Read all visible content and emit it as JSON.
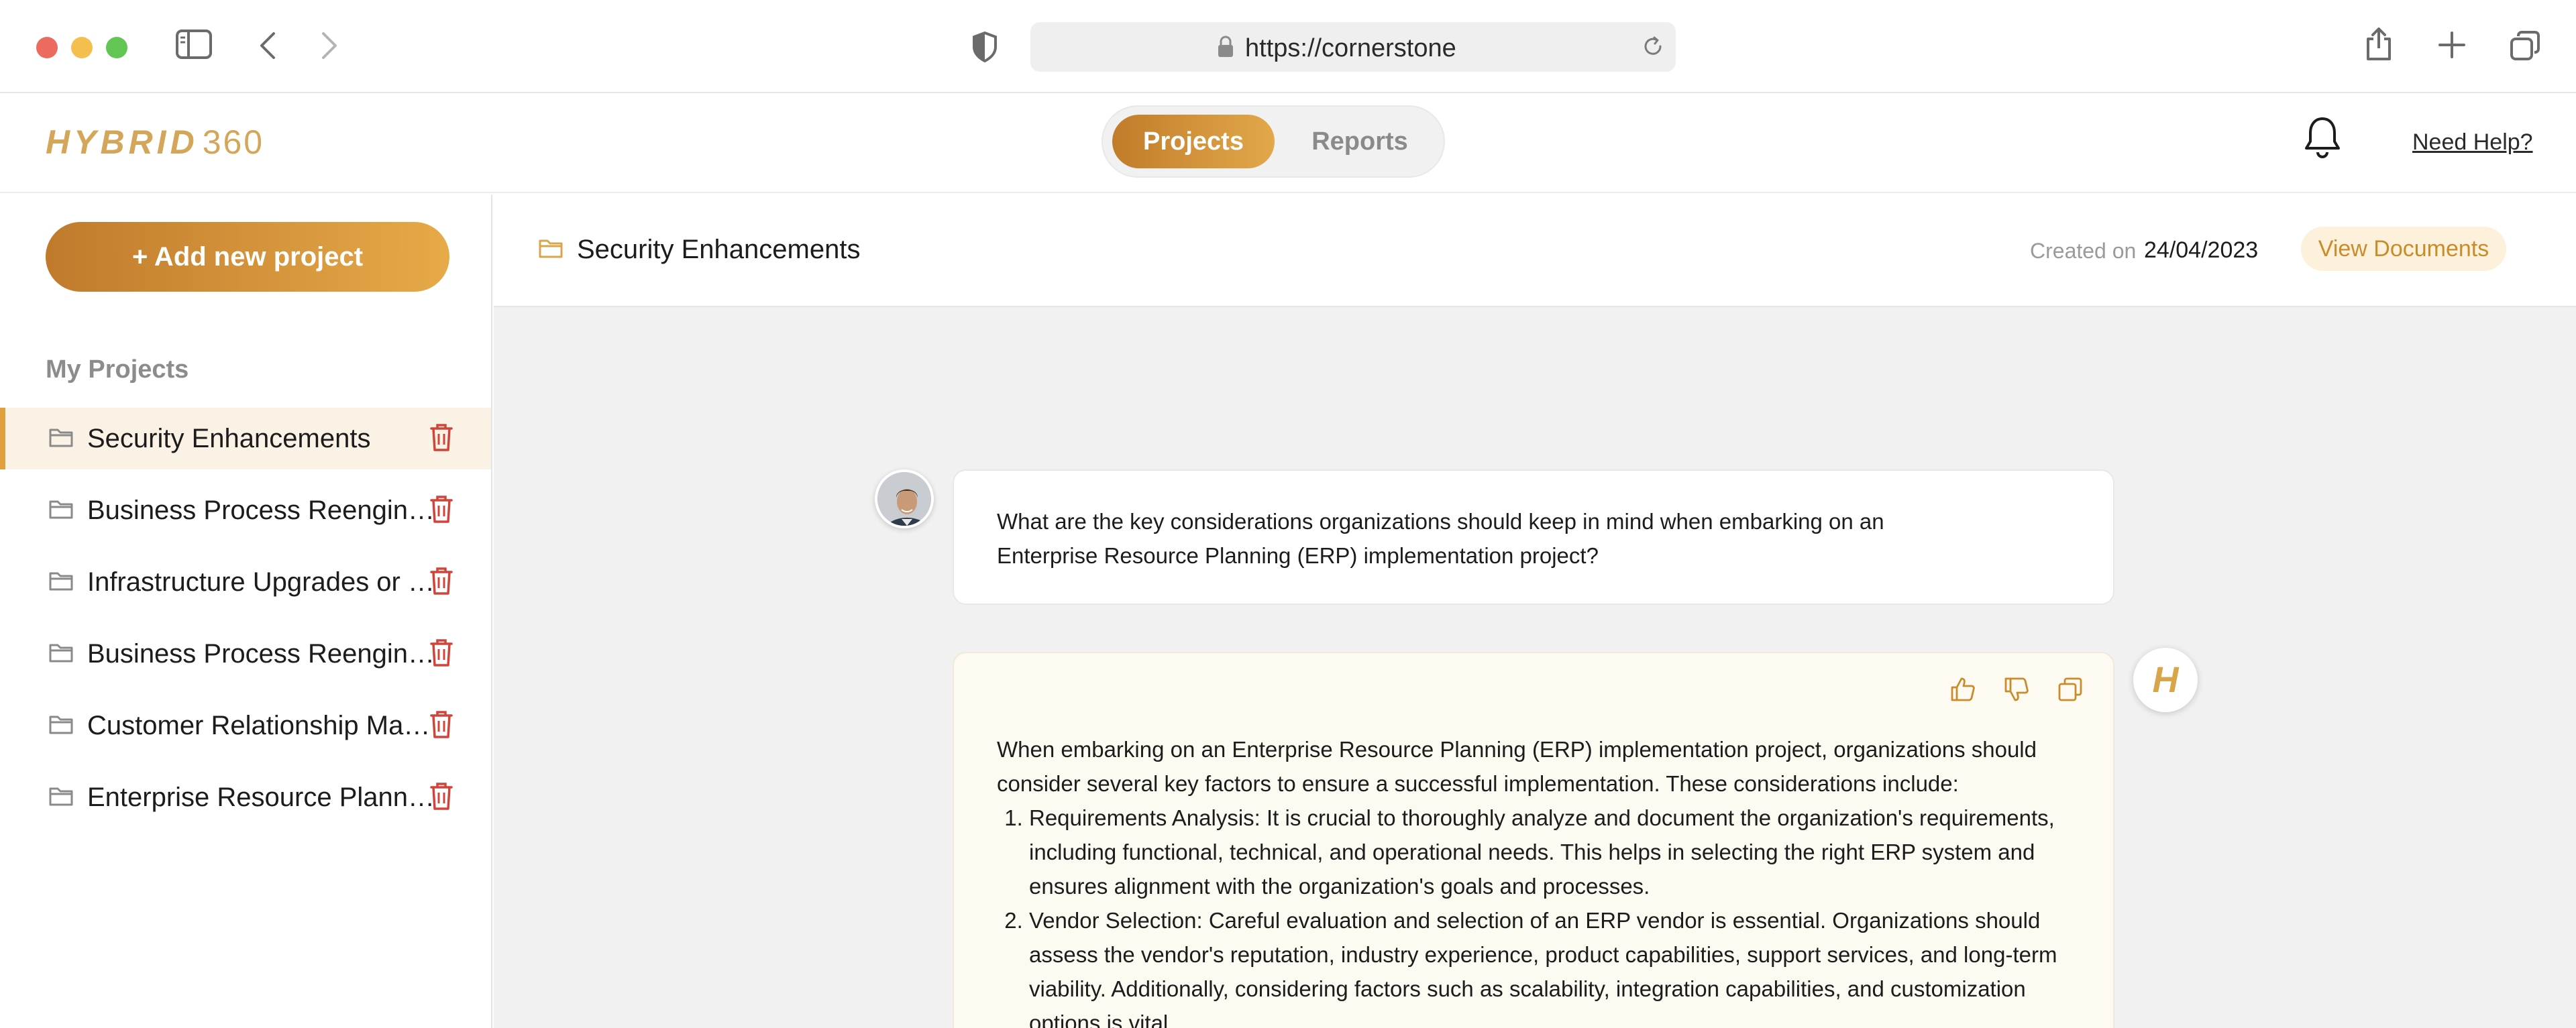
{
  "browser": {
    "url": "https://cornerstone"
  },
  "header": {
    "logo_bold": "HYBRID",
    "logo_num": "360",
    "tabs": [
      {
        "label": "Projects",
        "active": true
      },
      {
        "label": "Reports",
        "active": false
      }
    ],
    "help_label": "Need Help?"
  },
  "sidebar": {
    "add_button_label": "+ Add new project",
    "section_title": "My Projects",
    "projects": [
      {
        "label": "Security Enhancements",
        "active": true
      },
      {
        "label": "Business Process Reengineering",
        "active": false
      },
      {
        "label": "Infrastructure Upgrades or Migrations",
        "active": false
      },
      {
        "label": "Business Process Reengineering",
        "active": false
      },
      {
        "label": "Customer Relationship Management",
        "active": false
      },
      {
        "label": "Enterprise Resource Planning",
        "active": false
      }
    ]
  },
  "main": {
    "title": "Security Enhancements",
    "created_label": "Created on",
    "created_date": "24/04/2023",
    "view_documents_label": "View Documents",
    "question": "What are the key considerations organizations should keep in mind when embarking on an Enterprise Resource Planning (ERP) implementation project?",
    "answer_intro": "When embarking on an Enterprise Resource Planning (ERP) implementation project, organizations should consider several key factors to ensure a successful implementation. These considerations include:",
    "answer_items": [
      "Requirements Analysis: It is crucial to thoroughly analyze and document the organization's requirements, including functional, technical, and operational needs. This helps in selecting the right ERP system and ensures alignment with the organization's goals and processes.",
      "Vendor Selection: Careful evaluation and selection of an ERP vendor is essential. Organizations should assess the vendor's reputation, industry experience, product capabilities, support services, and long-term viability. Additionally, considering factors such as scalability, integration capabilities, and customization options is vital."
    ],
    "assistant_badge": "H"
  },
  "colors": {
    "accent": "#e0a040",
    "accent_dark": "#c17c2a",
    "trash": "#d0443a"
  }
}
